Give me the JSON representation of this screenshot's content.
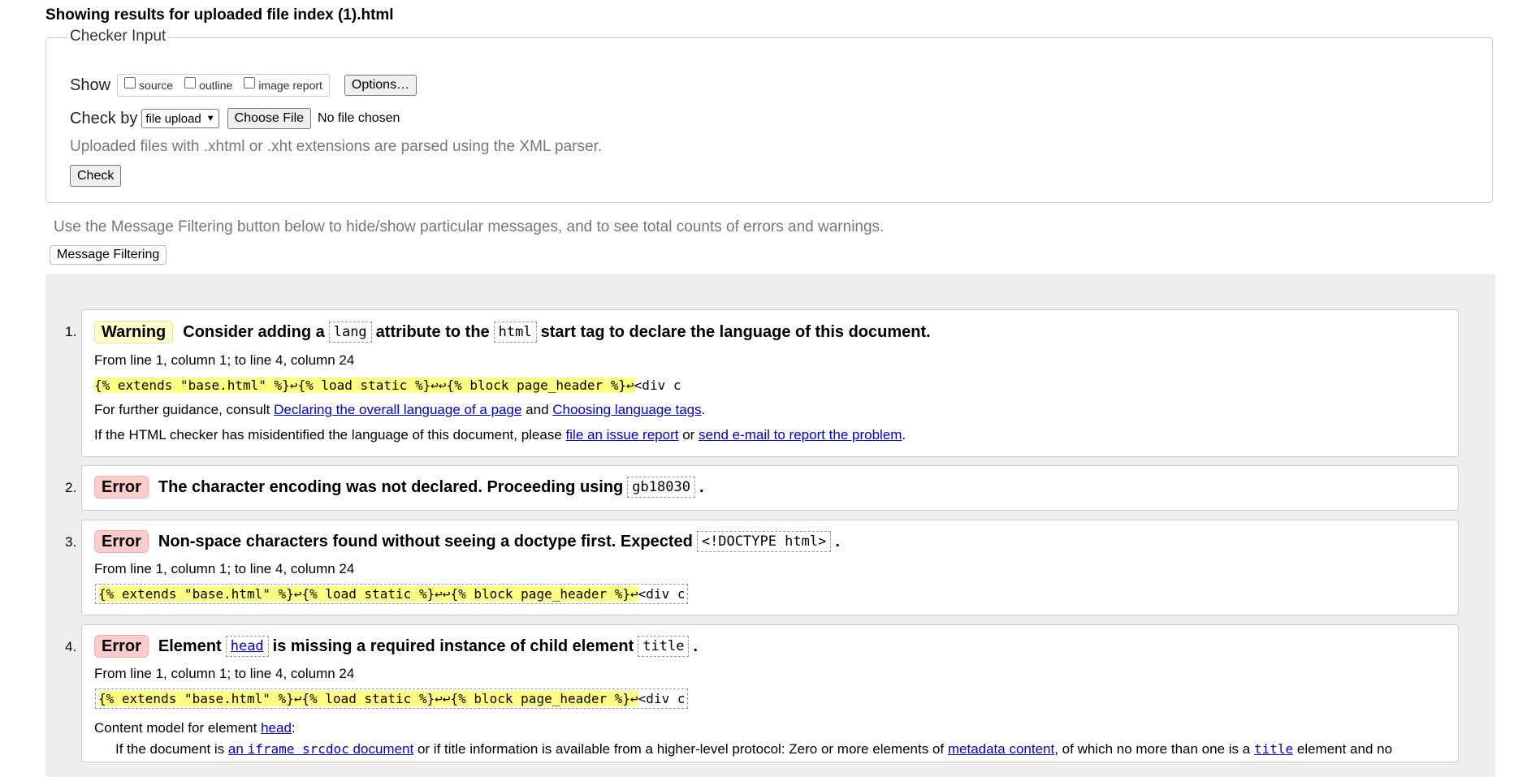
{
  "heading": "Showing results for uploaded file index (1).html",
  "checker": {
    "legend": "Checker Input",
    "show_label": "Show",
    "show_options": [
      "source",
      "outline",
      "image report"
    ],
    "options_button": "Options…",
    "check_by_label": "Check by",
    "check_by_selected": "file upload",
    "choose_file_button": "Choose File",
    "file_status": "No file chosen",
    "upload_note": "Uploaded files with .xhtml or .xht extensions are parsed using the XML parser.",
    "check_button": "Check"
  },
  "filter_note": "Use the Message Filtering button below to hide/show particular messages, and to see total counts of errors and warnings.",
  "filter_button": "Message Filtering",
  "extract": {
    "highlighted": "{% extends \"base.html\" %}↩{% load static %}↩↩{% block page_header %}↩",
    "rest": "<div c"
  },
  "messages": [
    {
      "num": "1.",
      "type": "Warning",
      "parts": [
        "Consider adding a",
        "lang",
        "attribute to the",
        "html",
        "start tag to declare the language of this document."
      ],
      "location": "From line 1, column 1; to line 4, column 24",
      "guidance_pre": "For further guidance, consult",
      "guidance_link1": "Declaring the overall language of a page",
      "guidance_mid": "and",
      "guidance_link2": "Choosing language tags",
      "guidance_end": ".",
      "issue_pre": "If the HTML checker has misidentified the language of this document, please",
      "issue_link1": "file an issue report",
      "issue_mid": "or",
      "issue_link2": "send e-mail to report the problem",
      "issue_end": "."
    },
    {
      "num": "2.",
      "type": "Error",
      "parts": [
        "The character encoding was not declared. Proceeding using",
        "gb18030",
        "."
      ]
    },
    {
      "num": "3.",
      "type": "Error",
      "parts": [
        "Non-space characters found without seeing a doctype first. Expected",
        "<!DOCTYPE html>",
        "."
      ],
      "location": "From line 1, column 1; to line 4, column 24"
    },
    {
      "num": "4.",
      "type": "Error",
      "parts": [
        "Element",
        "head",
        "is missing a required instance of child element",
        "title",
        "."
      ],
      "location": "From line 1, column 1; to line 4, column 24",
      "content_model_pre": "Content model for element",
      "content_model_link": "head",
      "content_model_end": ":",
      "cm_text1": "If the document is",
      "cm_link1a": "an",
      "cm_link1b": "iframe srcdoc",
      "cm_link1c": "document",
      "cm_text2": "or if title information is available from a higher-level protocol: Zero or more elements of",
      "cm_link2": "metadata content",
      "cm_text3": ", of which no more than one is a",
      "cm_link3": "title",
      "cm_text4": "element and no"
    }
  ]
}
